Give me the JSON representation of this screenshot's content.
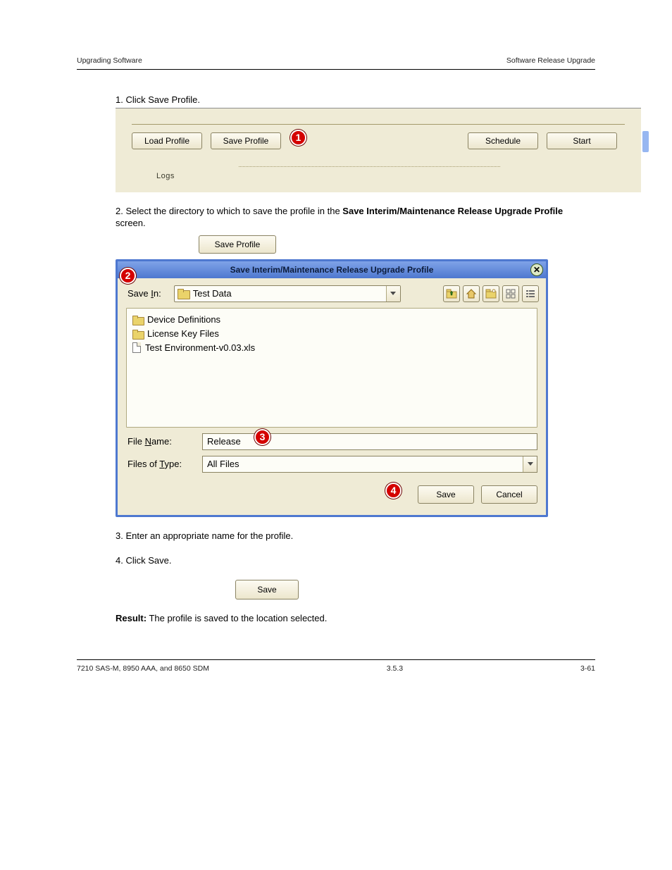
{
  "header": {
    "left": "Upgrading Software",
    "right": "Software Release Upgrade"
  },
  "steps": {
    "s1": "1. Click Save Profile.",
    "s2_a": "2. Select the directory to which to save the profile in the ",
    "s2_b": "Save Interim/Maintenance Release Upgrade Profile",
    "s2_c": " screen.",
    "s3": "3. Enter an appropriate name for the profile.",
    "s4": "4. Click Save.",
    "s5_a": "Result:",
    "s5_b": " The profile is saved to the location selected."
  },
  "upper_panel": {
    "load": "Load Profile",
    "save": "Save Profile",
    "schedule": "Schedule",
    "start": "Start",
    "logs": "Logs"
  },
  "save_profile_button": "Save Profile",
  "dialog": {
    "title": "Save Interim/Maintenance Release Upgrade Profile",
    "save_in_label": "Save In:",
    "save_in_value": "Test Data",
    "items": {
      "folder1": "Device Definitions",
      "folder2": "License Key Files",
      "file1": "Test Environment-v0.03.xls"
    },
    "file_name_label_pre": "File ",
    "file_name_label_u": "N",
    "file_name_label_post": "ame:",
    "file_name_value": "Release",
    "file_type_label_pre": "Files of ",
    "file_type_label_u": "T",
    "file_type_label_post": "ype:",
    "file_type_value": "All Files",
    "save": "Save",
    "cancel": "Cancel"
  },
  "save_lone": "Save",
  "footer": {
    "left": "7210 SAS-M, 8950 AAA, and 8650 SDM",
    "center": "3.5.3",
    "right": "3-61"
  },
  "callouts": {
    "c1": "1",
    "c2": "2",
    "c3": "3",
    "c4": "4"
  }
}
